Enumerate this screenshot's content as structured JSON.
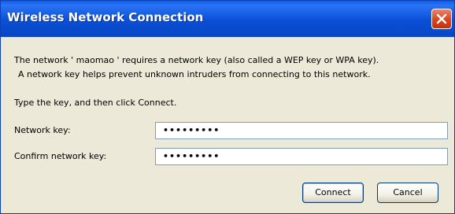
{
  "window": {
    "title": "Wireless Network Connection",
    "close_icon": "close-icon",
    "colors": {
      "titlebar": "#0a4fd6",
      "close": "#d8441f",
      "body": "#ece9d8"
    }
  },
  "message": {
    "line1": "The network '  maomao ' requires a network key (also called a WEP key or WPA key).",
    "line2": "A network key helps prevent unknown intruders from connecting to this network."
  },
  "instruction": "Type the key, and then click Connect.",
  "fields": {
    "network_key": {
      "label": "Network key:",
      "value": "•••••••••"
    },
    "confirm_key": {
      "label": "Confirm network key:",
      "value": "•••••••••"
    }
  },
  "buttons": {
    "connect": "Connect",
    "cancel": "Cancel"
  }
}
